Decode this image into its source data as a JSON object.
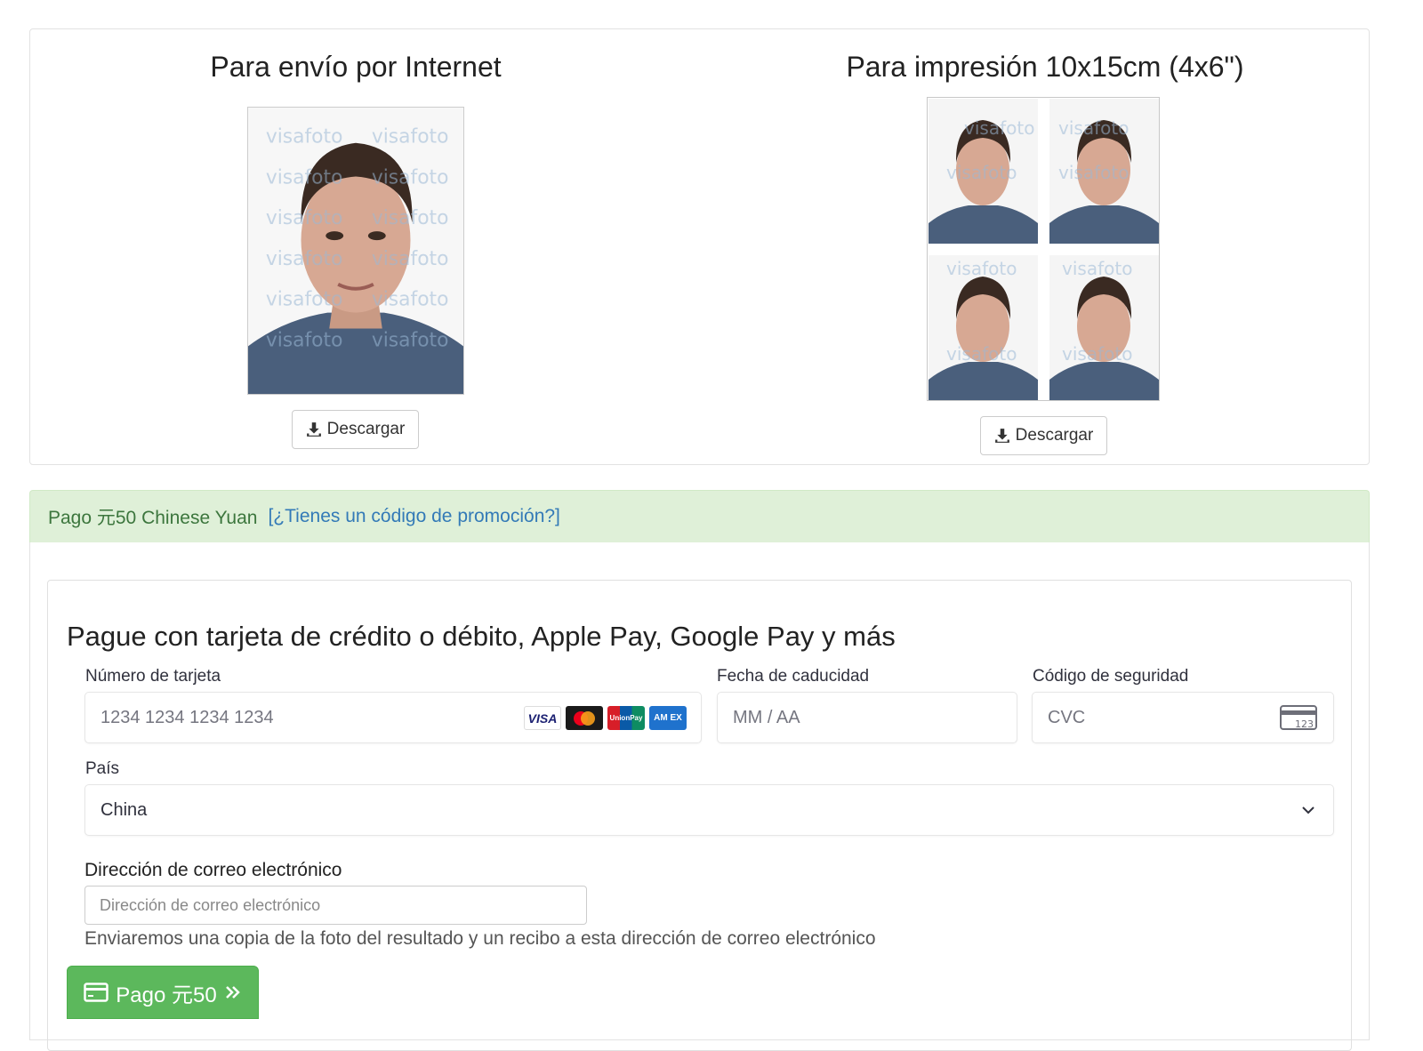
{
  "photos": {
    "internet_title": "Para envío por Internet",
    "print_title": "Para impresión 10x15cm (4x6\")",
    "watermark": "visafoto",
    "download_label": "Descargar"
  },
  "payment": {
    "amount_text": "Pago 元50 Chinese Yuan",
    "promo_link": "[¿Tienes un código de promoción?]",
    "title": "Pague con tarjeta de crédito o débito, Apple Pay, Google Pay y más",
    "card_number_label": "Número de tarjeta",
    "card_number_placeholder": "1234 1234 1234 1234",
    "expiry_label": "Fecha de caducidad",
    "expiry_placeholder": "MM / AA",
    "cvc_label": "Código de seguridad",
    "cvc_placeholder": "CVC",
    "cvc_icon_text": "123",
    "country_label": "País",
    "country_value": "China",
    "email_label": "Dirección de correo electrónico",
    "email_placeholder": "Dirección de correo electrónico",
    "email_help": "Enviaremos una copia de la foto del resultado y un recibo a esta dirección de correo electrónico",
    "pay_button": "Pago 元50",
    "brands": {
      "visa": "VISA",
      "unionpay": "UnionPay",
      "amex": "AM EX"
    },
    "colors": {
      "success_bg": "#dff0d8",
      "success_text": "#3c763d",
      "link": "#337ab7",
      "pay_button": "#5cb85c"
    }
  }
}
